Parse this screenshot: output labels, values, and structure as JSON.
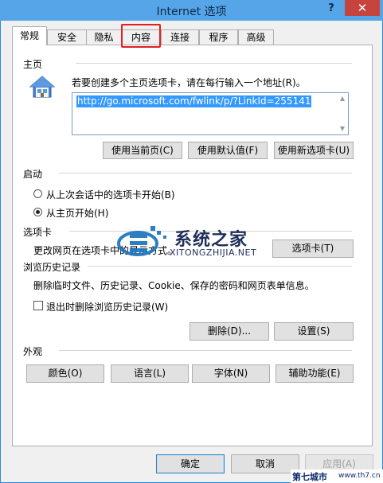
{
  "window": {
    "title": "Internet 选项",
    "help": "?",
    "close": "✕"
  },
  "tabs": [
    {
      "label": "常规"
    },
    {
      "label": "安全"
    },
    {
      "label": "隐私"
    },
    {
      "label": "内容"
    },
    {
      "label": "连接"
    },
    {
      "label": "程序"
    },
    {
      "label": "高级"
    }
  ],
  "home": {
    "section": "主页",
    "instruction": "若要创建多个主页选项卡，请在每行输入一个地址(R)。",
    "url": "http://go.microsoft.com/fwlink/p/?LinkId=255141",
    "btn_current": "使用当前页(C)",
    "btn_default": "使用默认值(F)",
    "btn_newtab": "使用新选项卡(U)"
  },
  "startup": {
    "section": "启动",
    "option1": "从上次会话中的选项卡开始(B)",
    "option2": "从主页开始(H)"
  },
  "tabsec": {
    "section": "选项卡",
    "desc": "更改网页在选项卡中的显示方式。",
    "btn": "选项卡(T)"
  },
  "history": {
    "section": "浏览历史记录",
    "desc": "删除临时文件、历史记录、Cookie、保存的密码和网页表单信息。",
    "checkbox": "退出时删除浏览历史记录(W)",
    "btn_delete": "删除(D)...",
    "btn_settings": "设置(S)"
  },
  "appearance": {
    "section": "外观",
    "btn_colors": "颜色(O)",
    "btn_languages": "语言(L)",
    "btn_fonts": "字体(N)",
    "btn_access": "辅助功能(E)"
  },
  "footer": {
    "ok": "确定",
    "cancel": "取消",
    "apply": "应用(A)"
  },
  "watermark": {
    "name": "系统之家",
    "site": "XITONGZHIJIA.NET",
    "corner": "第七城市",
    "corner_site": "www.th7.cn"
  }
}
